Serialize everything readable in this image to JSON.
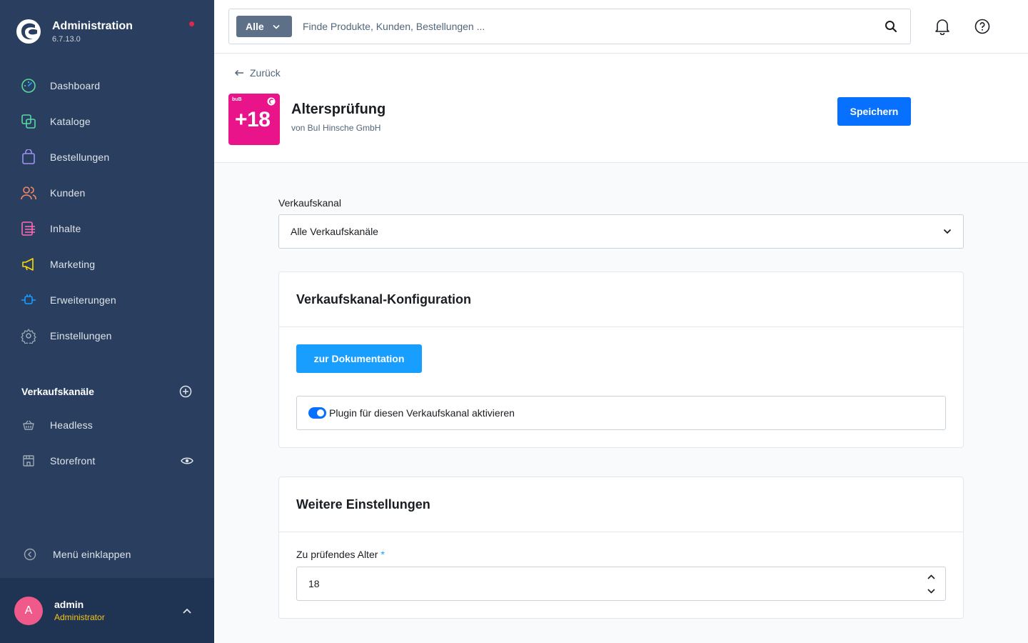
{
  "app": {
    "title": "Administration",
    "version": "6.7.13.0"
  },
  "sidebar": {
    "items": [
      {
        "label": "Dashboard",
        "icon": "dashboard-icon",
        "color": "#57d9a3"
      },
      {
        "label": "Kataloge",
        "icon": "catalog-icon",
        "color": "#57d9a3"
      },
      {
        "label": "Bestellungen",
        "icon": "orders-icon",
        "color": "#a092f0"
      },
      {
        "label": "Kunden",
        "icon": "customers-icon",
        "color": "#f88962"
      },
      {
        "label": "Inhalte",
        "icon": "content-icon",
        "color": "#ff68b4"
      },
      {
        "label": "Marketing",
        "icon": "marketing-icon",
        "color": "#ffd700"
      },
      {
        "label": "Erweiterungen",
        "icon": "extensions-icon",
        "color": "#189eff"
      },
      {
        "label": "Einstellungen",
        "icon": "settings-icon",
        "color": "#9aa8b5"
      }
    ],
    "sales_channels": {
      "title": "Verkaufskanäle",
      "items": [
        {
          "label": "Headless",
          "icon": "basket-icon"
        },
        {
          "label": "Storefront",
          "icon": "storefront-icon"
        }
      ]
    },
    "collapse_label": "Menü einklappen",
    "user": {
      "initial": "A",
      "name": "admin",
      "role": "Administrator"
    }
  },
  "search": {
    "type_label": "Alle",
    "placeholder": "Finde Produkte, Kunden, Bestellungen ..."
  },
  "page": {
    "back_label": "Zurück",
    "plugin_badge": "+18",
    "plugin_brand": "buB",
    "plugin_title": "Altersprüfung",
    "plugin_author": "von BuI Hinsche GmbH",
    "save_label": "Speichern"
  },
  "content": {
    "sales_channel_label": "Verkaufskanal",
    "sales_channel_value": "Alle Verkaufskanäle",
    "card1": {
      "title": "Verkaufskanal-Konfiguration",
      "doc_button": "zur Dokumentation",
      "toggle_label": "Plugin für diesen Verkaufskanal aktivieren",
      "toggle_on": true
    },
    "card2": {
      "title": "Weitere Einstellungen",
      "age_label": "Zu prüfendes Alter",
      "required_mark": "*",
      "age_value": "18"
    }
  },
  "colors": {
    "sidebar_bg": "#2a3f5f",
    "primary": "#0870ff",
    "accent": "#189eff",
    "plugin_icon_bg": "#e9148a"
  }
}
